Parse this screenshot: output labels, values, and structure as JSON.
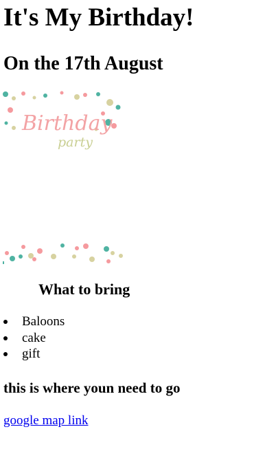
{
  "page": {
    "title": "It's My Birthday!",
    "date_heading": "On the 17th August",
    "banner": {
      "line1": "Birthday",
      "line2": "party",
      "colors": {
        "pink": "#f59a9e",
        "teal": "#4fb3a2",
        "beige": "#d7d2a0",
        "text_pink": "#f3a3a5",
        "text_olive": "#c9cf93"
      }
    },
    "bring_heading": "What to bring",
    "bring_items": [
      "Baloons",
      "cake",
      "gift"
    ],
    "where_heading": "this is where youn need to go",
    "map_link_text": "google map link",
    "colors": {
      "link": "#0000ee",
      "text": "#000000",
      "background": "#ffffff"
    }
  }
}
